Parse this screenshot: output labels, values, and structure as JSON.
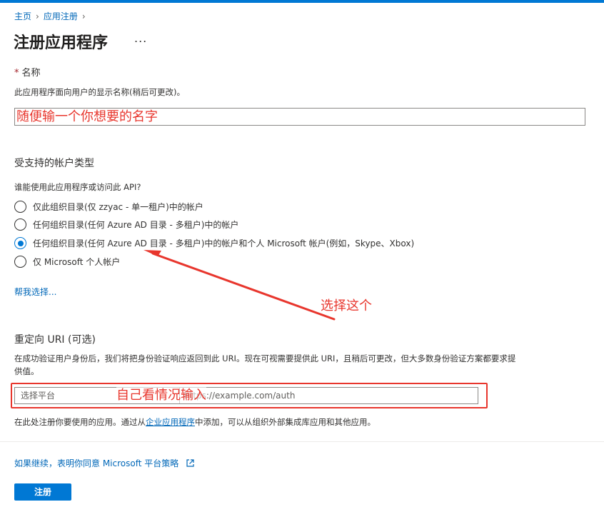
{
  "breadcrumb": {
    "home": "主页",
    "app_registrations": "应用注册"
  },
  "page": {
    "title": "注册应用程序",
    "more": "..."
  },
  "name_section": {
    "label": "名称",
    "description": "此应用程序面向用户的显示名称(稍后可更改)。",
    "input_value": "随便输一个你想要的名字"
  },
  "account_types": {
    "heading": "受支持的帐户类型",
    "question": "谁能使用此应用程序或访问此 API?",
    "options": [
      {
        "label": "仅此组织目录(仅 zzyac - 单一租户)中的帐户",
        "checked": false
      },
      {
        "label": "任何组织目录(任何 Azure AD 目录 - 多租户)中的帐户",
        "checked": false
      },
      {
        "label": "任何组织目录(任何 Azure AD 目录 - 多租户)中的帐户和个人 Microsoft 帐户(例如，Skype、Xbox)",
        "checked": true
      },
      {
        "label": "仅 Microsoft 个人帐户",
        "checked": false
      }
    ],
    "help_link": "帮我选择..."
  },
  "annotations": {
    "choose_this": "选择这个",
    "decide_input": "自己看情况输入"
  },
  "redirect": {
    "heading": "重定向 URI (可选)",
    "description_line1": "在成功验证用户身份后，我们将把身份验证响应返回到此 URI。现在可视需要提供此 URI，且稍后可更改，但大多数身份验证方案都要求提",
    "description_line2": "供值。",
    "platform_placeholder": "选择平台",
    "uri_placeholder": "https://example.com/auth",
    "note_prefix": "在此处注册你要使用的应用。通过从",
    "note_link": "企业应用程序",
    "note_suffix": "中添加，可以从组织外部集成库应用和其他应用。"
  },
  "footer": {
    "policy_link": "如果继续，表明你同意 Microsoft 平台策略",
    "register_label": "注册"
  },
  "colors": {
    "accent": "#0078d4",
    "link": "#0067b8",
    "annotation": "#e8362d"
  }
}
